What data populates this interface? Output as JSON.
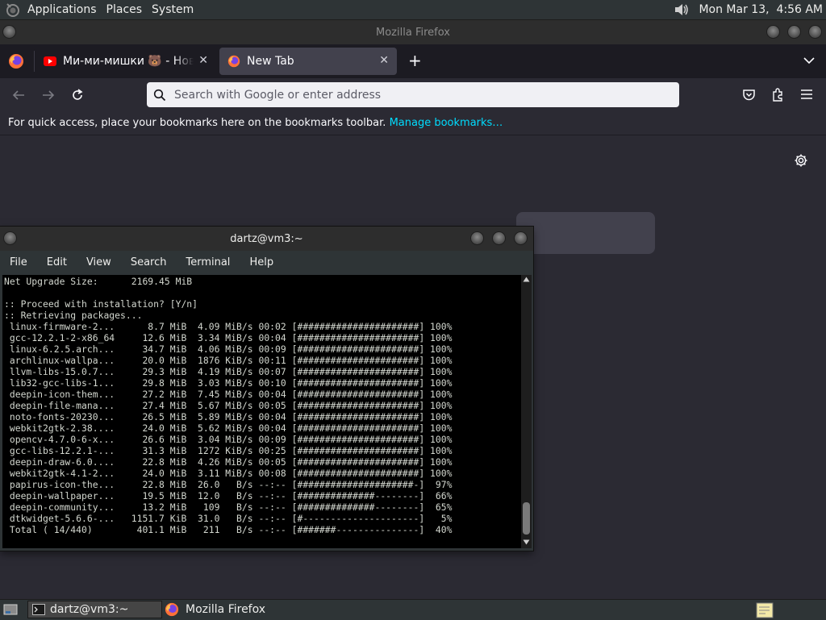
{
  "top_panel": {
    "menus": [
      "Applications",
      "Places",
      "System"
    ],
    "clock": "Mon Mar 13,  4:56 AM"
  },
  "firefox": {
    "window_title": "Mozilla Firefox",
    "tabs": [
      {
        "label": "Ми-ми-мишки 🐻 - Новые серии",
        "active": false
      },
      {
        "label": "New Tab",
        "active": true
      }
    ],
    "urlbar": {
      "placeholder": "Search with Google or enter address",
      "value": ""
    },
    "bookmarks_bar": {
      "text": "For quick access, place your bookmarks here on the bookmarks toolbar.",
      "link": "Manage bookmarks…"
    }
  },
  "terminal": {
    "title": "dartz@vm3:~",
    "menus": [
      "File",
      "Edit",
      "View",
      "Search",
      "Terminal",
      "Help"
    ],
    "lines": [
      "Net Upgrade Size:      2169.45 MiB",
      "",
      ":: Proceed with installation? [Y/n]",
      ":: Retrieving packages...",
      " linux-firmware-2...      8.7 MiB  4.09 MiB/s 00:02 [######################] 100%",
      " gcc-12.2.1-2-x86_64     12.6 MiB  3.34 MiB/s 00:04 [######################] 100%",
      " linux-6.2.5.arch...     34.7 MiB  4.06 MiB/s 00:09 [######################] 100%",
      " archlinux-wallpa...     20.0 MiB  1876 KiB/s 00:11 [######################] 100%",
      " llvm-libs-15.0.7...     29.3 MiB  4.19 MiB/s 00:07 [######################] 100%",
      " lib32-gcc-libs-1...     29.8 MiB  3.03 MiB/s 00:10 [######################] 100%",
      " deepin-icon-them...     27.2 MiB  7.45 MiB/s 00:04 [######################] 100%",
      " deepin-file-mana...     27.4 MiB  5.67 MiB/s 00:05 [######################] 100%",
      " noto-fonts-20230...     26.5 MiB  5.89 MiB/s 00:04 [######################] 100%",
      " webkit2gtk-2.38....     24.0 MiB  5.62 MiB/s 00:04 [######################] 100%",
      " opencv-4.7.0-6-x...     26.6 MiB  3.04 MiB/s 00:09 [######################] 100%",
      " gcc-libs-12.2.1-...     31.3 MiB  1272 KiB/s 00:25 [######################] 100%",
      " deepin-draw-6.0....     22.8 MiB  4.26 MiB/s 00:05 [######################] 100%",
      " webkit2gtk-4.1-2...     24.0 MiB  3.11 MiB/s 00:08 [######################] 100%",
      " papirus-icon-the...     22.8 MiB  26.0   B/s --:-- [#####################-]  97%",
      " deepin-wallpaper...     19.5 MiB  12.0   B/s --:-- [##############--------]  66%",
      " deepin-community...     13.2 MiB   109   B/s --:-- [##############--------]  65%",
      " dtkwidget-5.6.6-...   1151.7 KiB  31.0   B/s --:-- [#---------------------]   5%",
      " Total ( 14/440)        401.1 MiB   211   B/s --:-- [#######---------------]  40%"
    ]
  },
  "taskbar": {
    "items": [
      {
        "label": "dartz@vm3:~",
        "active": true
      },
      {
        "label": "Mozilla Firefox",
        "active": false
      }
    ]
  }
}
